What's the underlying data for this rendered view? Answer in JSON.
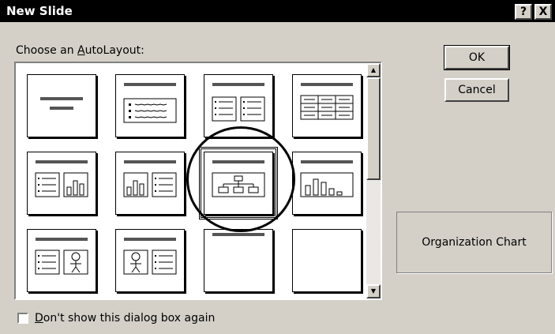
{
  "title": "New Slide",
  "title_buttons": {
    "help": "?",
    "close": "X"
  },
  "prompt": {
    "prefix": "Choose an ",
    "accel": "A",
    "suffix": "utoLayout:"
  },
  "buttons": {
    "ok": "OK",
    "cancel": "Cancel"
  },
  "preview_label": "Organization Chart",
  "checkbox": {
    "accel": "D",
    "suffix": "on't show this dialog box again",
    "checked": false
  },
  "layouts": [
    {
      "name": "Title Slide"
    },
    {
      "name": "Bulleted List"
    },
    {
      "name": "2 Column Text"
    },
    {
      "name": "Table"
    },
    {
      "name": "Text & Chart"
    },
    {
      "name": "Chart & Text"
    },
    {
      "name": "Organization Chart",
      "selected": true
    },
    {
      "name": "Chart"
    },
    {
      "name": "Text & Clip Art"
    },
    {
      "name": "Clip Art & Text"
    },
    {
      "name": "Title Only"
    },
    {
      "name": "Blank"
    }
  ],
  "scroll": {
    "up": "▲",
    "down": "▼"
  }
}
